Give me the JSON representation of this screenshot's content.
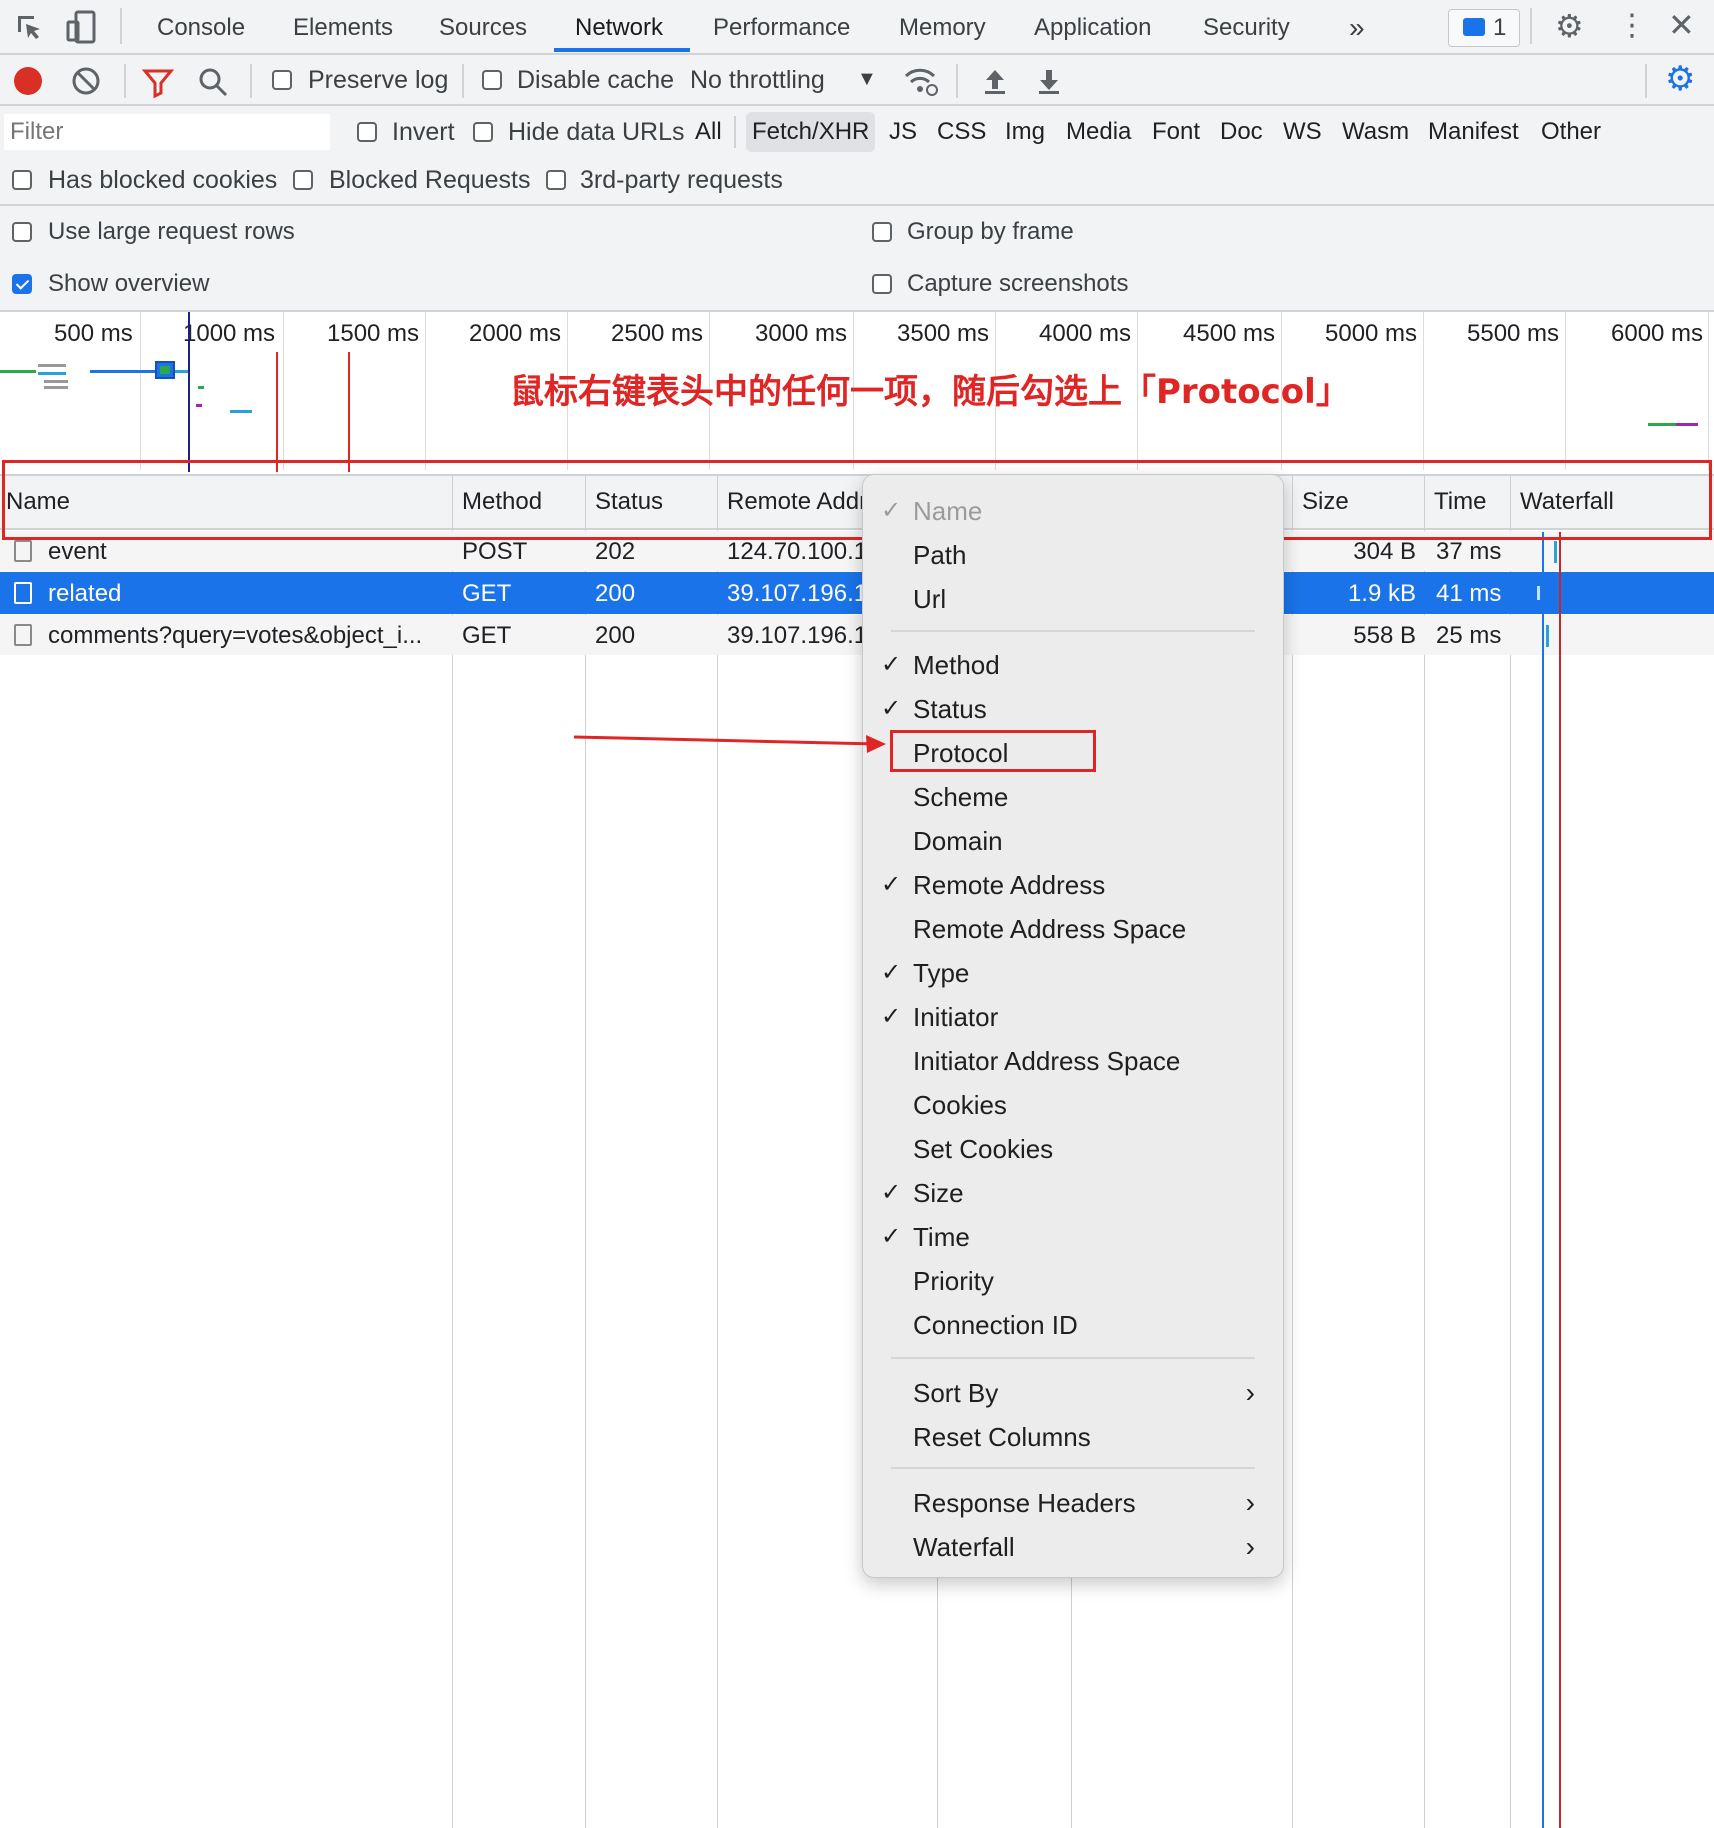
{
  "tabs": [
    "Console",
    "Elements",
    "Sources",
    "Network",
    "Performance",
    "Memory",
    "Application",
    "Security"
  ],
  "more_tabs_label": "»",
  "issues_badge": "1",
  "toolbar": {
    "preserve_log": "Preserve log",
    "disable_cache": "Disable cache",
    "throttling": "No throttling"
  },
  "filter": {
    "placeholder": "Filter",
    "invert": "Invert",
    "hide_data_urls": "Hide data URLs",
    "types": [
      "All",
      "Fetch/XHR",
      "JS",
      "CSS",
      "Img",
      "Media",
      "Font",
      "Doc",
      "WS",
      "Wasm",
      "Manifest",
      "Other"
    ],
    "active_type": "Fetch/XHR",
    "has_blocked_cookies": "Has blocked cookies",
    "blocked_requests": "Blocked Requests",
    "third_party": "3rd-party requests"
  },
  "settings": {
    "large_rows": "Use large request rows",
    "group_by_frame": "Group by frame",
    "show_overview": "Show overview",
    "show_overview_checked": true,
    "capture_screenshots": "Capture screenshots"
  },
  "timeline_ticks": [
    "500 ms",
    "1000 ms",
    "1500 ms",
    "2000 ms",
    "2500 ms",
    "3000 ms",
    "3500 ms",
    "4000 ms",
    "4500 ms",
    "5000 ms",
    "5500 ms",
    "6000 ms"
  ],
  "annotation_text": "鼠标右键表头中的任何一项，随后勾选上「Protocol」",
  "columns": [
    "Name",
    "Method",
    "Status",
    "Remote Addr",
    "Size",
    "Time",
    "Waterfall"
  ],
  "rows": [
    {
      "name": "event",
      "method": "POST",
      "status": "202",
      "remote": "124.70.100.1",
      "size": "304 B",
      "time": "37 ms",
      "selected": false
    },
    {
      "name": "related",
      "method": "GET",
      "status": "200",
      "remote": "39.107.196.1",
      "size": "1.9 kB",
      "time": "41 ms",
      "selected": true
    },
    {
      "name": "comments?query=votes&object_i...",
      "method": "GET",
      "status": "200",
      "remote": "39.107.196.1",
      "size": "558 B",
      "time": "25 ms",
      "selected": false
    }
  ],
  "menu": {
    "items": [
      {
        "label": "Name",
        "checked": true,
        "disabled": true
      },
      {
        "label": "Path",
        "checked": false
      },
      {
        "label": "Url",
        "checked": false
      },
      {
        "label": "Method",
        "checked": true
      },
      {
        "label": "Status",
        "checked": true
      },
      {
        "label": "Protocol",
        "checked": false,
        "highlighted": true
      },
      {
        "label": "Scheme",
        "checked": false
      },
      {
        "label": "Domain",
        "checked": false
      },
      {
        "label": "Remote Address",
        "checked": true
      },
      {
        "label": "Remote Address Space",
        "checked": false
      },
      {
        "label": "Type",
        "checked": true
      },
      {
        "label": "Initiator",
        "checked": true
      },
      {
        "label": "Initiator Address Space",
        "checked": false
      },
      {
        "label": "Cookies",
        "checked": false
      },
      {
        "label": "Set Cookies",
        "checked": false
      },
      {
        "label": "Size",
        "checked": true
      },
      {
        "label": "Time",
        "checked": true
      },
      {
        "label": "Priority",
        "checked": false
      },
      {
        "label": "Connection ID",
        "checked": false
      }
    ],
    "sort_by": "Sort By",
    "reset_columns": "Reset Columns",
    "response_headers": "Response Headers",
    "waterfall": "Waterfall",
    "check_glyph": "✓",
    "submenu_glyph": "›"
  },
  "colors": {
    "accent": "#1a73e8",
    "record_red": "#d93025",
    "annotation_red": "#e02525",
    "selected_row": "#1a73e8"
  }
}
